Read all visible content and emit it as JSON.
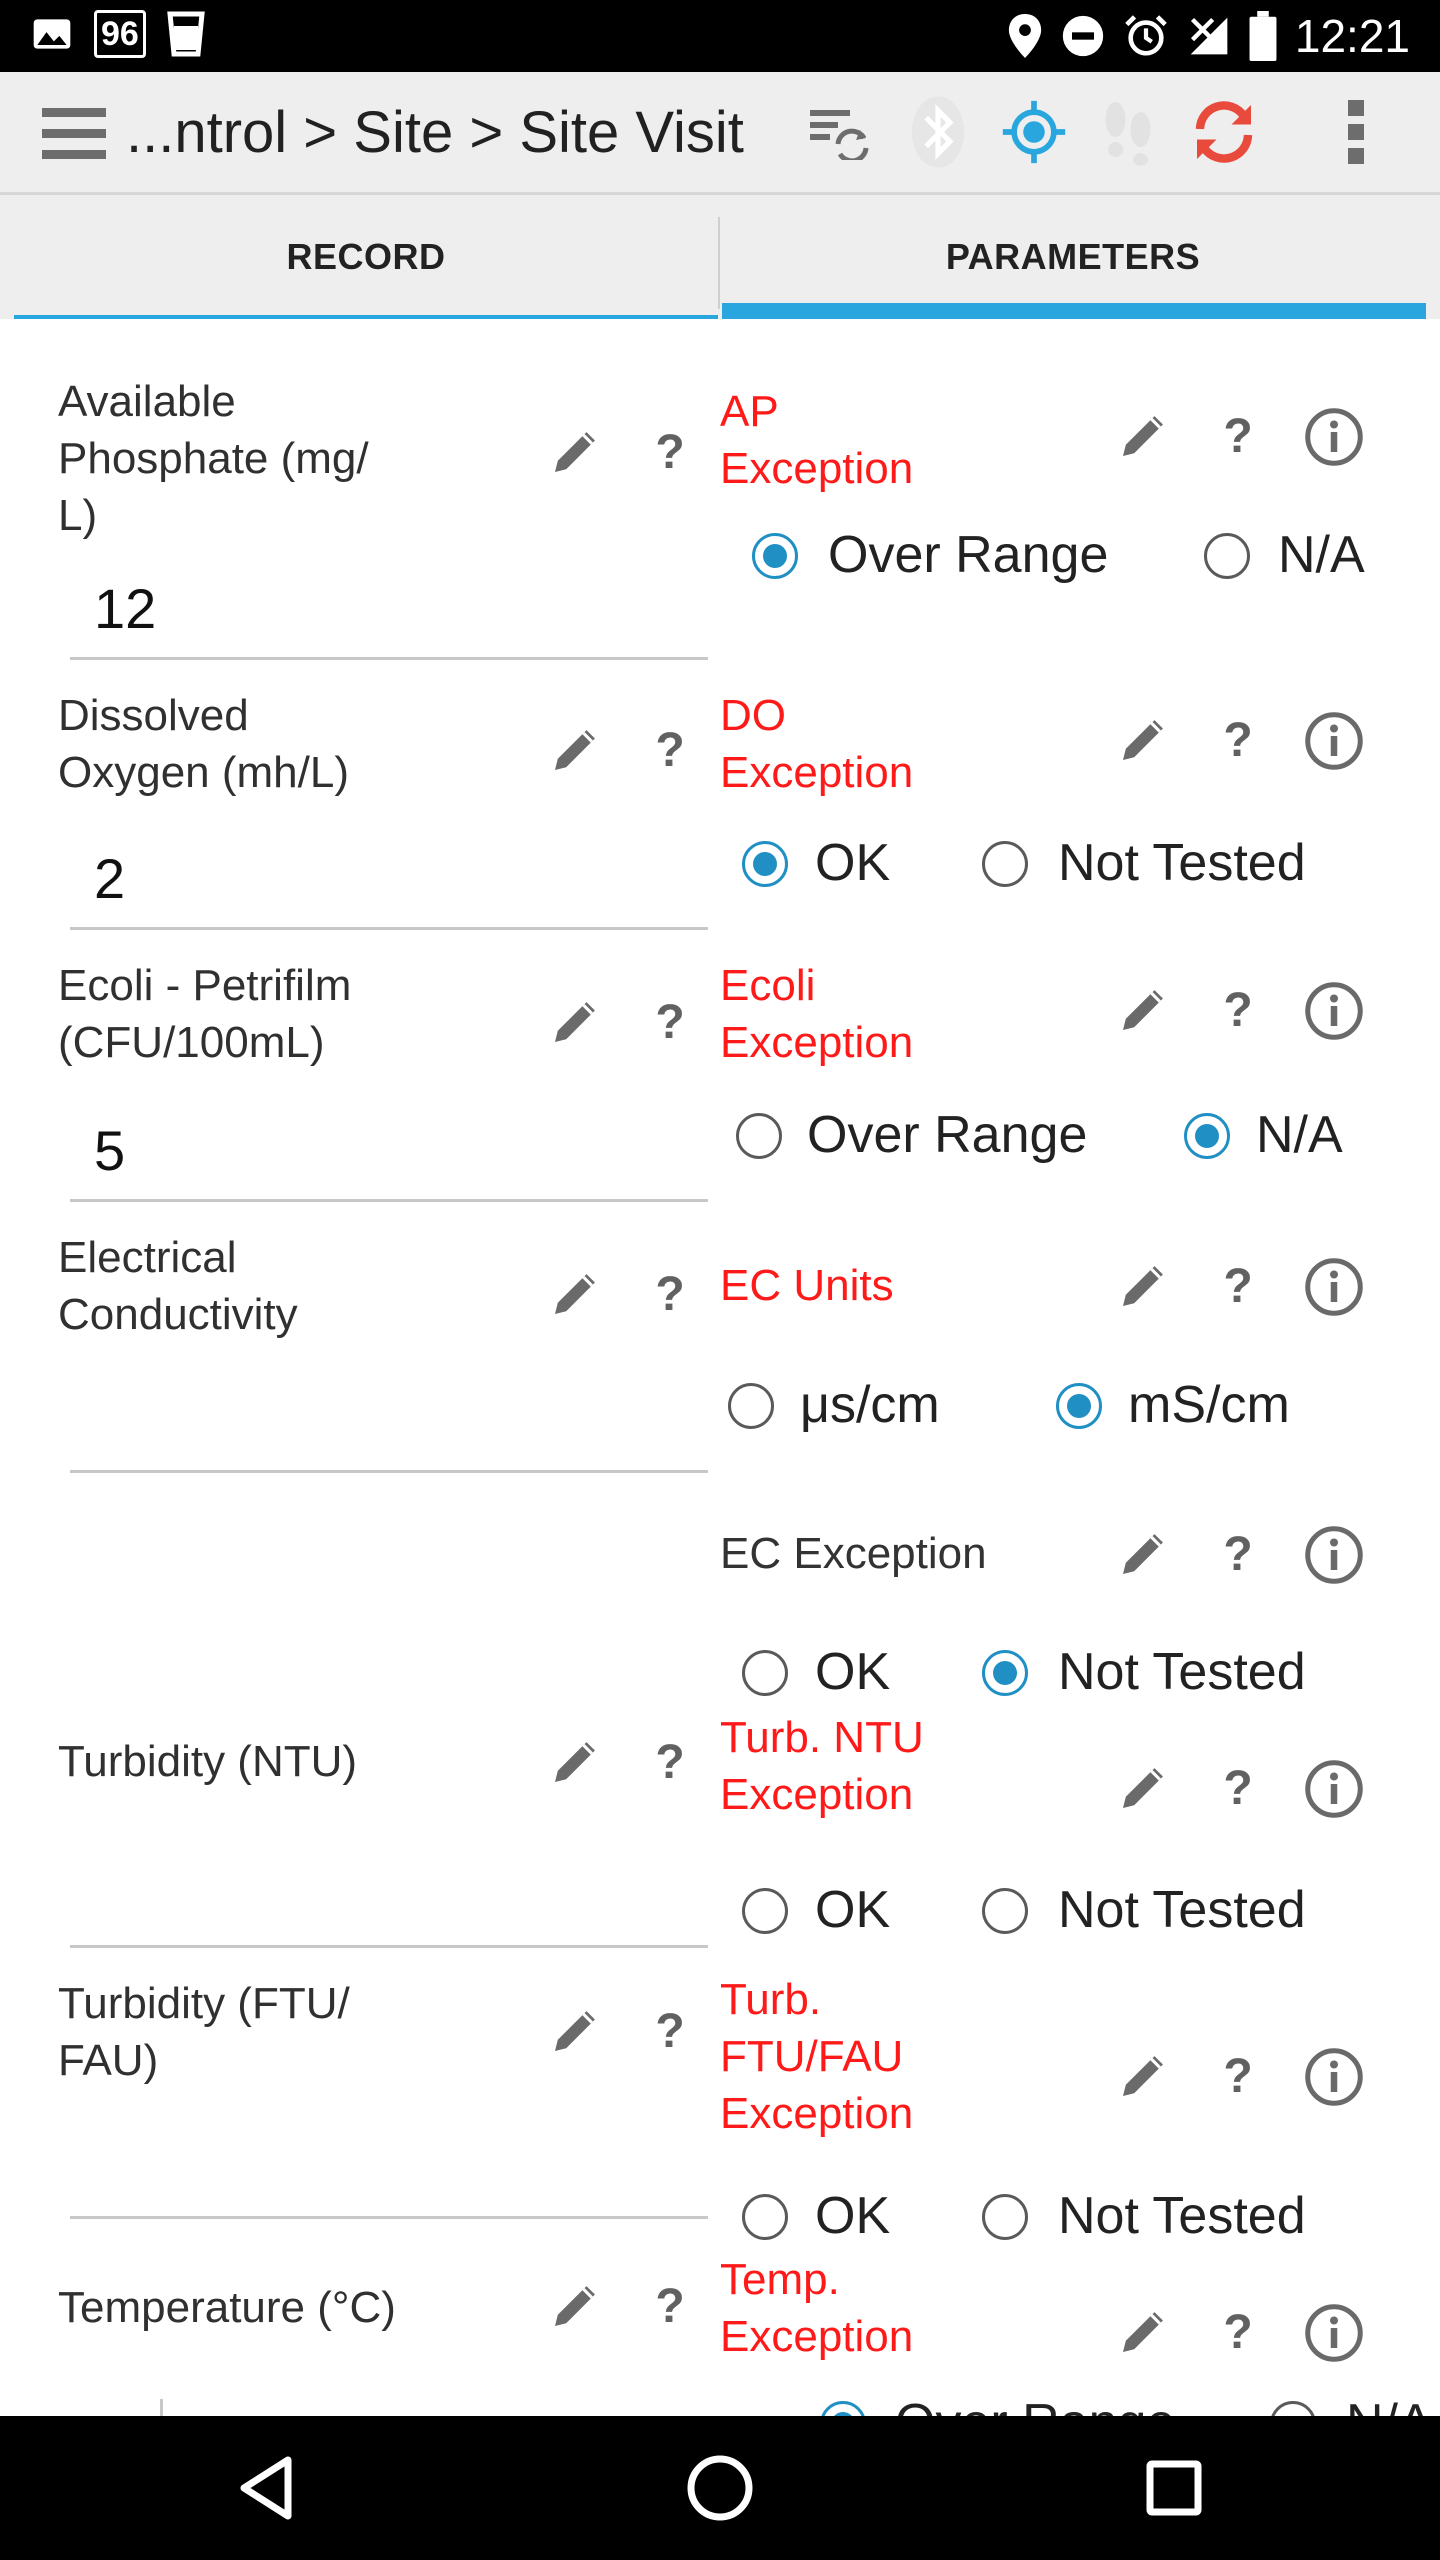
{
  "status_bar": {
    "badge": "96",
    "time": "12:21",
    "left_icons": [
      "image-icon",
      "cup-icon"
    ],
    "right_icons": [
      "location-icon",
      "do-not-disturb-icon",
      "alarm-icon",
      "no-signal-icon",
      "battery-icon"
    ]
  },
  "action_bar": {
    "title": "...ntrol > Site > Site Visit",
    "icons": [
      "menu-icon",
      "sync-list-icon",
      "bluetooth-icon",
      "gps-icon",
      "footsteps-icon",
      "refresh-icon",
      "overflow-menu-icon"
    ],
    "colors": {
      "gps": "#29a6dd",
      "refresh": "#e84a3c"
    }
  },
  "tabs": [
    {
      "label": "RECORD"
    },
    {
      "label": "PARAMETERS",
      "selected": true
    }
  ],
  "record_fields": [
    {
      "label": "Available Phosphate (mg/ L)",
      "lines": [
        "Available",
        "Phosphate (mg/",
        "L)"
      ],
      "value": "12"
    },
    {
      "label": "Dissolved Oxygen (mh/L)",
      "lines": [
        "Dissolved",
        "Oxygen (mh/L)"
      ],
      "value": "2"
    },
    {
      "label": "Ecoli - Petrifilm (CFU/100mL)",
      "lines": [
        "Ecoli - Petrifilm",
        "(CFU/100mL)"
      ],
      "value": "5"
    },
    {
      "label": "Electrical Conductivity",
      "lines": [
        "Electrical",
        "Conductivity"
      ],
      "value": ""
    },
    {
      "label": "Turbidity (NTU)",
      "lines": [
        "Turbidity (NTU)"
      ],
      "value": ""
    },
    {
      "label": "Turbidity (FTU/ FAU)",
      "lines": [
        "Turbidity (FTU/",
        "FAU)"
      ],
      "value": ""
    },
    {
      "label": "Temperature (°C)",
      "lines": [
        "Temperature (°C)"
      ],
      "value": ""
    }
  ],
  "param_fields": [
    {
      "label": "AP Exception",
      "lines": [
        "AP",
        "Exception"
      ],
      "color": "#ff1a1a",
      "options": [
        "Over Range",
        "N/A"
      ],
      "selected": "Over Range"
    },
    {
      "label": "DO Exception",
      "lines": [
        "DO",
        "Exception"
      ],
      "color": "#ff1a1a",
      "options": [
        "OK",
        "Not Tested"
      ],
      "selected": "OK"
    },
    {
      "label": "Ecoli Exception",
      "lines": [
        "Ecoli",
        "Exception"
      ],
      "color": "#ff1a1a",
      "options": [
        "Over Range",
        "N/A"
      ],
      "selected": "N/A"
    },
    {
      "label": "EC Units",
      "lines": [
        "EC Units"
      ],
      "color": "#ff1a1a",
      "options": [
        "μs/cm",
        "mS/cm"
      ],
      "selected": "mS/cm"
    },
    {
      "label": "EC Exception",
      "lines": [
        "EC Exception"
      ],
      "color": "#333333",
      "options": [
        "OK",
        "Not Tested"
      ],
      "selected": "Not Tested"
    },
    {
      "label": "Turb. NTU Exception",
      "lines": [
        "Turb. NTU",
        "Exception"
      ],
      "color": "#ff1a1a",
      "options": [
        "OK",
        "Not Tested"
      ],
      "selected": ""
    },
    {
      "label": "Turb. FTU/FAU Exception",
      "lines": [
        "Turb.",
        "FTU/FAU",
        "Exception"
      ],
      "color": "#ff1a1a",
      "options": [
        "OK",
        "Not Tested"
      ],
      "selected": ""
    },
    {
      "label": "Temp. Exception",
      "lines": [
        "Temp.",
        "Exception"
      ],
      "color": "#ff1a1a",
      "options": [
        "Over Range",
        "N/A"
      ],
      "selected": "Over Range"
    }
  ],
  "field_icons": {
    "edit": "pencil-icon",
    "help": "?",
    "info": "info-icon"
  },
  "nav_bar": {
    "icons": [
      "back-icon",
      "home-icon",
      "recents-icon"
    ]
  }
}
